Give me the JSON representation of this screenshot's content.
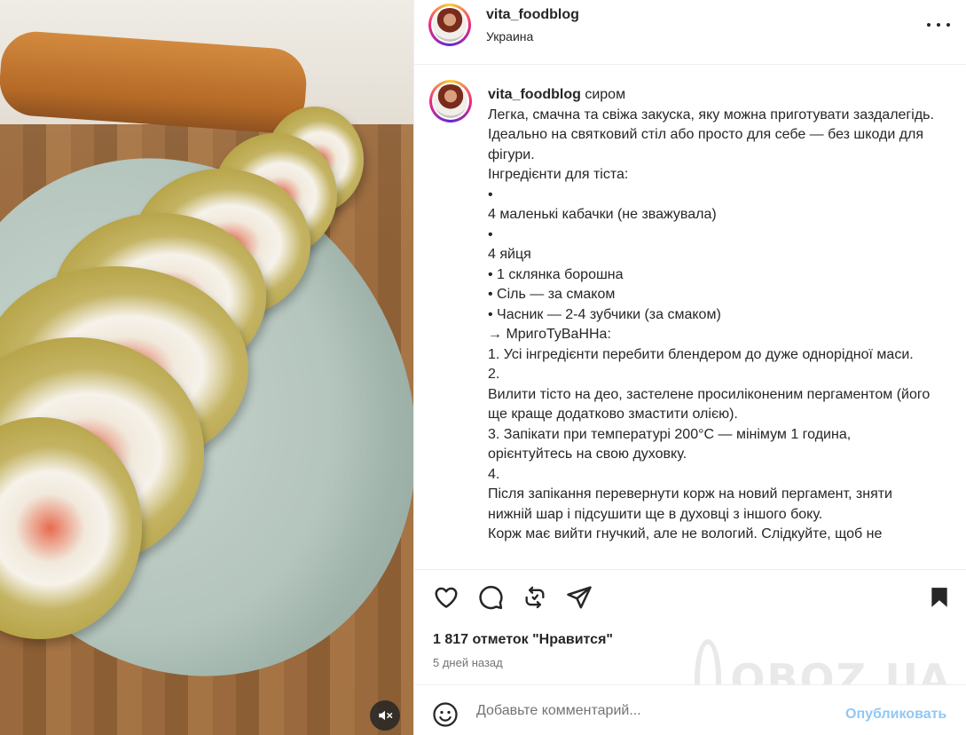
{
  "post": {
    "username": "vita_foodblog",
    "location": "Украина"
  },
  "caption": {
    "username": "vita_foodblog",
    "lines": [
      "сиром",
      "Легка, смачна та свіжа закуска, яку можна приготувати заздалегідь. Ідеально на святковий стіл або просто для себе — без шкоди для фігури.",
      "Інгредієнти для тіста:",
      "•",
      "4 маленькі кабачки (не зважувала)",
      "•",
      "4 яйця",
      "• 1 склянка борошна",
      "• Сіль — за смаком",
      "• Часник — 2-4 зубчики (за смаком)",
      "→ МригоТуВаННа:",
      "1. Усі інгредієнти перебити блендером до дуже однорідної маси.",
      "2.",
      "Вилити тісто на део, застелене просиліконеним пергаментом (його ще краще додатково змастити олією).",
      "3. Запікати при температурі 200°С — мінімум 1 година, орієнтуйтесь на свою духовку.",
      "4.",
      "Після запікання перевернути корж на новий пергамент, зняти нижній шар і підсушити ще в духовці з іншого боку.",
      "Корж має вийти гнучкий, але не вологий. Слідкуйте, щоб не"
    ]
  },
  "actions": {
    "like_icon": "heart-icon",
    "comment_icon": "comment-icon",
    "repost_icon": "repost-icon",
    "share_icon": "share-icon",
    "save_icon": "bookmark-icon"
  },
  "stats": {
    "likes": "1 817 отметок \"Нравится\"",
    "date": "5 дней назад"
  },
  "watermark": "OBOZ.UA",
  "comment": {
    "placeholder": "Добавьте комментарий...",
    "publish_label": "Опубликовать"
  },
  "colors": {
    "publish_disabled": "#8fc8f6",
    "text": "#262626",
    "muted": "#737373"
  }
}
